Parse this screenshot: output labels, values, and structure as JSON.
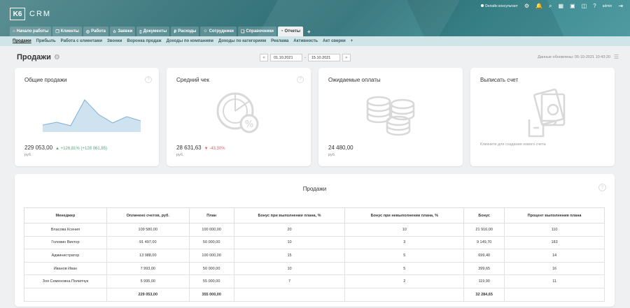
{
  "app": {
    "logo_mark": "K6",
    "logo_text": "CRM"
  },
  "topbar": {
    "online_label": "Онлайн консультант",
    "user": "admin"
  },
  "main_tabs": [
    {
      "label": "Начало работы",
      "icon": "home-icon",
      "glyph": "⌂"
    },
    {
      "label": "Клиенты",
      "icon": "clients-icon",
      "glyph": "❐"
    },
    {
      "label": "Работа",
      "icon": "work-icon",
      "glyph": "◎"
    },
    {
      "label": "Заявки",
      "icon": "star-icon",
      "glyph": "☆"
    },
    {
      "label": "Документы",
      "icon": "document-icon",
      "glyph": "▯"
    },
    {
      "label": "Расходы",
      "icon": "expenses-icon",
      "glyph": "₽"
    },
    {
      "label": "Сотрудники",
      "icon": "staff-icon",
      "glyph": "☺"
    },
    {
      "label": "Справочники",
      "icon": "book-icon",
      "glyph": "❑"
    },
    {
      "label": "Отчеты",
      "icon": "reports-icon",
      "glyph": "◔"
    }
  ],
  "sub_tabs": [
    "Продажи",
    "Прибыль",
    "Работа с клиентами",
    "Звонки",
    "Воронка продаж",
    "Доходы по компаниям",
    "Доходы по категориям",
    "Реклама",
    "Активность",
    "Акт сверки"
  ],
  "page": {
    "title": "Продажи",
    "updated": "Данные обновлены: 05-10-2021 10:43:20"
  },
  "dates": {
    "prev": "«",
    "from": "01.10.2021",
    "sep": "-",
    "to": "15.10.2021",
    "next": "»"
  },
  "cards": {
    "total": {
      "title": "Общие продажи",
      "value": "229 053,00",
      "change": "▲ +126,81% (+128 061,85)",
      "currency": "руб."
    },
    "avg": {
      "title": "Средний чек",
      "value": "28 631,63",
      "change": "▼ -43,30%",
      "currency": "руб."
    },
    "expected": {
      "title": "Ожидаемые оплаты",
      "value": "24 480,00",
      "currency": "руб."
    },
    "invoice": {
      "title": "Выписать счет",
      "hint": "Кликните для создания нового счета"
    }
  },
  "sales_table": {
    "title": "Продажи",
    "headers": [
      "Менеджер",
      "Оплачено счетов, руб.",
      "План",
      "Бонус при выполнении плана, %",
      "Бонус при невыполнении плана, %",
      "Бонус",
      "Процент выполнения плана"
    ],
    "rows": [
      [
        "Власова Ксения",
        "109 580,00",
        "100 000,00",
        "20",
        "10",
        "21 916,00",
        "110"
      ],
      [
        "Головин Виктор",
        "91 497,00",
        "50 000,00",
        "10",
        "3",
        "9 149,70",
        "183"
      ],
      [
        "Администратор",
        "13 988,00",
        "100 000,00",
        "15",
        "5",
        "699,40",
        "14"
      ],
      [
        "Иванов Иван",
        "7 993,00",
        "50 000,00",
        "10",
        "5",
        "399,65",
        "16"
      ],
      [
        "Зоя Семеновна Полипчук",
        "5 995,00",
        "55 000,00",
        "7",
        "2",
        "119,90",
        "11"
      ]
    ],
    "total": [
      "",
      "229 053,00",
      "355 000,00",
      "",
      "",
      "32 284,65",
      ""
    ]
  },
  "colors": {
    "header": "#3f7a80",
    "subtabs": "#cfe5e7",
    "chart_fill": "#cfe2ef",
    "chart_line": "#7fb0d4",
    "up": "#5aa17f",
    "down": "#e06060"
  },
  "sparkline": [
    1.0,
    1.4,
    0.9,
    4.6,
    2.5,
    1.3,
    2.2,
    1.6
  ]
}
